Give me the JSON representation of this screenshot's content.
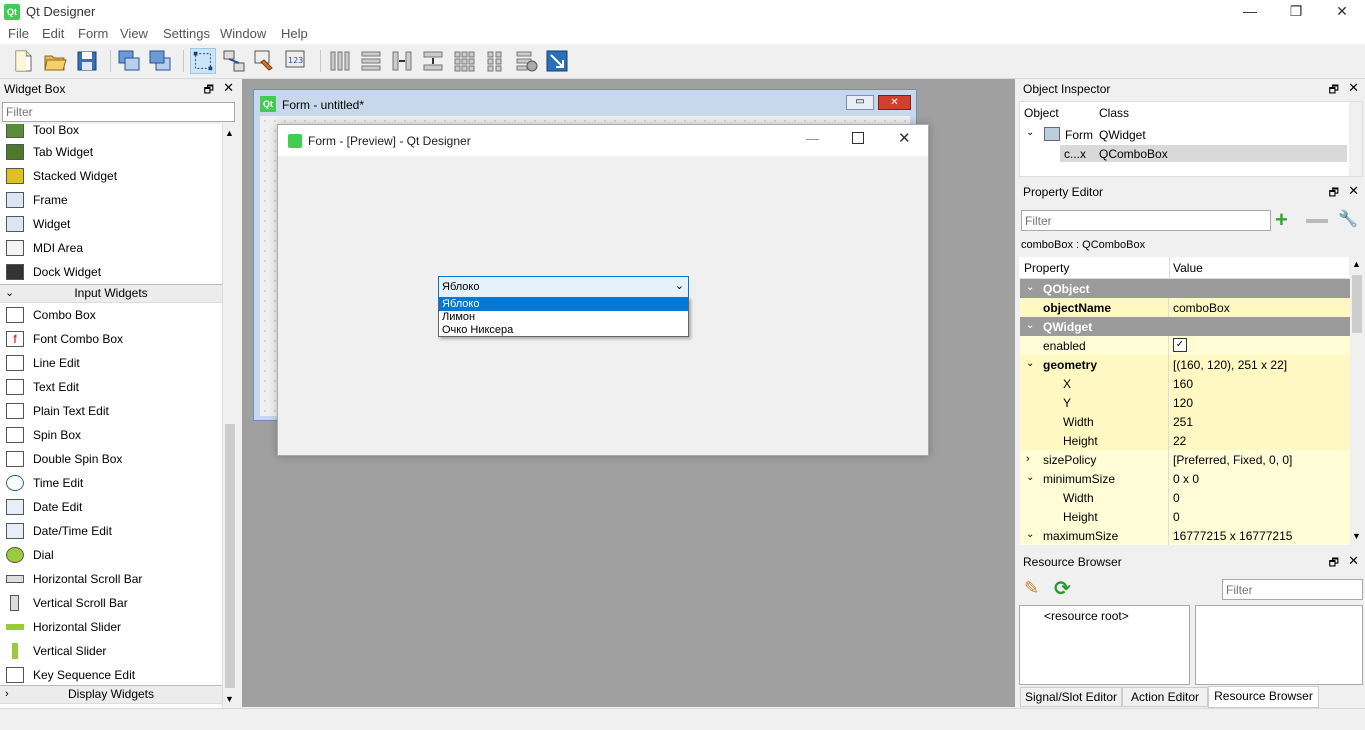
{
  "app": {
    "title": "Qt Designer",
    "logo": "Qt"
  },
  "window_controls": {
    "minimize": "—",
    "restore": "❐",
    "close": "✕"
  },
  "menu": [
    "File",
    "Edit",
    "Form",
    "Settings",
    "Window",
    "Help"
  ],
  "widget_box": {
    "title": "Widget Box",
    "filter_placeholder": "Filter",
    "items_top": [
      "Tool Box",
      "Tab Widget",
      "Stacked Widget",
      "Frame",
      "Widget",
      "MDI Area",
      "Dock Widget"
    ],
    "category_input": "Input Widgets",
    "items_input": [
      "Combo Box",
      "Font Combo Box",
      "Line Edit",
      "Text Edit",
      "Plain Text Edit",
      "Spin Box",
      "Double Spin Box",
      "Time Edit",
      "Date Edit",
      "Date/Time Edit",
      "Dial",
      "Horizontal Scroll Bar",
      "Vertical Scroll Bar",
      "Horizontal Slider",
      "Vertical Slider",
      "Key Sequence Edit"
    ],
    "category_display": "Display Widgets"
  },
  "form_window": {
    "title": "Form - untitled*"
  },
  "preview": {
    "title": "Form - [Preview] - Qt Designer",
    "combo_value": "Яблоко",
    "options": [
      "Яблоко",
      "Лимон",
      "Очко Никсера"
    ]
  },
  "object_inspector": {
    "title": "Object Inspector",
    "col_object": "Object",
    "col_class": "Class",
    "rows": [
      {
        "object": "Form",
        "class": "QWidget"
      },
      {
        "object": "c...x",
        "class": "QComboBox"
      }
    ]
  },
  "property_editor": {
    "title": "Property Editor",
    "filter_placeholder": "Filter",
    "context": "comboBox : QComboBox",
    "col_property": "Property",
    "col_value": "Value",
    "sect_qobject": "QObject",
    "sect_qwidget": "QWidget",
    "objectName": {
      "name": "objectName",
      "value": "comboBox"
    },
    "enabled": {
      "name": "enabled",
      "checked": true
    },
    "geometry": {
      "name": "geometry",
      "value": "[(160, 120), 251 x 22]"
    },
    "x": {
      "name": "X",
      "value": "160"
    },
    "y": {
      "name": "Y",
      "value": "120"
    },
    "width": {
      "name": "Width",
      "value": "251"
    },
    "height": {
      "name": "Height",
      "value": "22"
    },
    "sizePolicy": {
      "name": "sizePolicy",
      "value": "[Preferred, Fixed, 0, 0]"
    },
    "minimumSize": {
      "name": "minimumSize",
      "value": "0 x 0"
    },
    "min_width": {
      "name": "Width",
      "value": "0"
    },
    "min_height": {
      "name": "Height",
      "value": "0"
    },
    "maximumSize": {
      "name": "maximumSize",
      "value": "16777215 x 16777215"
    }
  },
  "resource_browser": {
    "title": "Resource Browser",
    "filter_placeholder": "Filter",
    "root": "<resource root>"
  },
  "bottom_tabs": [
    "Signal/Slot Editor",
    "Action Editor",
    "Resource Browser"
  ],
  "colors": {
    "qt_green": "#41cd52",
    "section_grey": "#9b9b9b",
    "selection_blue": "#cce8ff",
    "design_bg": "#a0a0a0"
  }
}
